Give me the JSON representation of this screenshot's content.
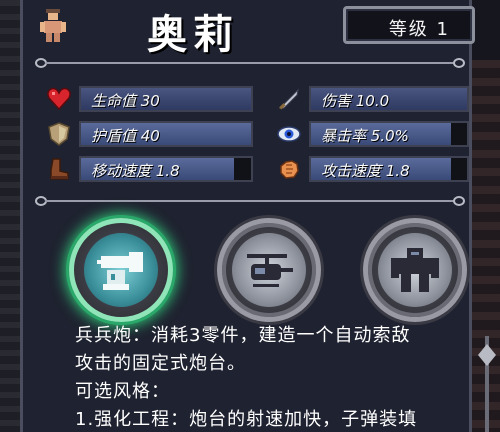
{
  "header": {
    "character_name": "奥莉",
    "level_text": "等级 1"
  },
  "stats": [
    {
      "icon": "heart-icon",
      "label": "生命值 30",
      "fill": 1.0
    },
    {
      "icon": "sword-icon",
      "label": "伤害 10.0",
      "fill": 1.0
    },
    {
      "icon": "shield-icon",
      "label": "护盾值 40",
      "fill": 1.0
    },
    {
      "icon": "eye-icon",
      "label": "暴击率 5.0%",
      "fill": 0.9
    },
    {
      "icon": "boot-icon",
      "label": "移动速度 1.8",
      "fill": 0.9
    },
    {
      "icon": "fist-icon",
      "label": "攻击速度 1.8",
      "fill": 0.9
    }
  ],
  "skills": [
    {
      "icon": "turret-icon",
      "active": true
    },
    {
      "icon": "helicopter-icon",
      "active": false
    },
    {
      "icon": "mech-icon",
      "active": false
    }
  ],
  "description": {
    "line1": "兵兵炮：消耗3零件，建造一个自动索敌",
    "line2": "攻击的固定式炮台。",
    "line3": "可选风格：",
    "line4": "1.强化工程：炮台的射速加快，子弹装填"
  },
  "colors": {
    "panel": "#1f2230",
    "bar_fill": "#4a5580",
    "active_glow": "#32d27e"
  }
}
